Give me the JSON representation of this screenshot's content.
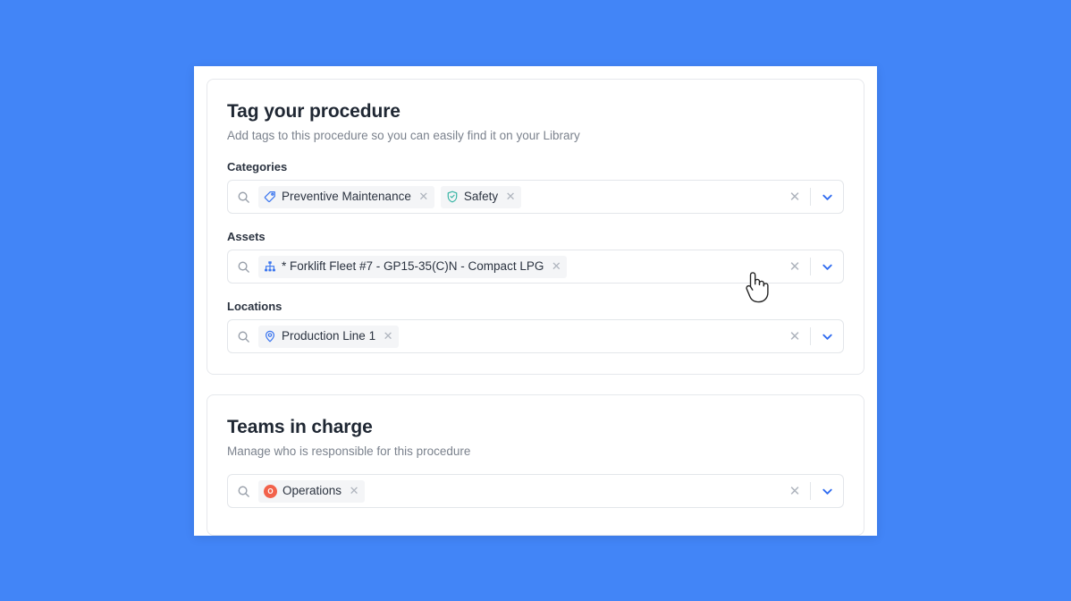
{
  "theme": {
    "background": "#4285f7",
    "accent": "#2f6bf0",
    "chip_background": "#f4f5f7",
    "text_primary": "#1f2733",
    "text_secondary": "#7b828d",
    "border": "#e3e6ea",
    "avatar_operations": "#f2624b",
    "icon_tag": "#3b76ef",
    "icon_shield": "#3bb6a6",
    "icon_sitemap": "#3b76ef",
    "icon_pin": "#3b76ef"
  },
  "tag_card": {
    "title": "Tag your procedure",
    "subtitle": "Add tags to this procedure so you can easily find it on your Library",
    "fields": [
      {
        "label": "Categories",
        "search_icon": "search-icon",
        "clear_label": "✕",
        "chevron": "chevron-down-icon",
        "chips": [
          {
            "icon": "tag-icon",
            "label": "Preventive Maintenance",
            "remove": "✕"
          },
          {
            "icon": "shield-check-icon",
            "label": "Safety",
            "remove": "✕"
          }
        ]
      },
      {
        "label": "Assets",
        "search_icon": "search-icon",
        "clear_label": "✕",
        "chevron": "chevron-down-icon",
        "chips": [
          {
            "icon": "sitemap-icon",
            "label": "* Forklift Fleet #7 - GP15-35(C)N - Compact LPG",
            "remove": "✕"
          }
        ]
      },
      {
        "label": "Locations",
        "search_icon": "search-icon",
        "clear_label": "✕",
        "chevron": "chevron-down-icon",
        "chips": [
          {
            "icon": "map-pin-icon",
            "label": "Production Line 1",
            "remove": "✕"
          }
        ]
      }
    ]
  },
  "teams_card": {
    "title": "Teams in charge",
    "subtitle": "Manage who is responsible for this procedure",
    "field": {
      "search_icon": "search-icon",
      "clear_label": "✕",
      "chevron": "chevron-down-icon",
      "chips": [
        {
          "icon": "avatar",
          "avatar_initial": "O",
          "label": "Operations",
          "remove": "✕"
        }
      ]
    }
  },
  "cursor": {
    "icon": "pointing-hand-cursor"
  }
}
